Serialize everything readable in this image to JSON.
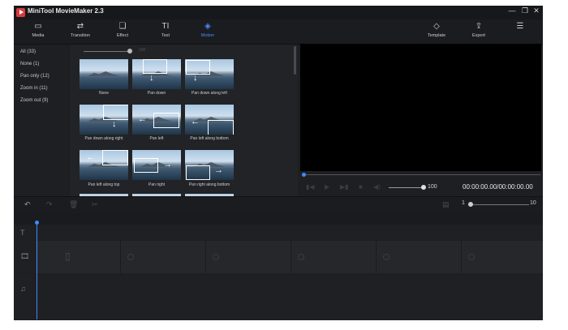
{
  "app": {
    "title": "MiniTool MovieMaker 2.3"
  },
  "window_controls": {
    "minimize": "—",
    "restore": "❐",
    "close": "✕"
  },
  "toolbar": {
    "tabs": [
      {
        "label": "Media",
        "icon": "folder-icon"
      },
      {
        "label": "Transition",
        "icon": "transition-icon"
      },
      {
        "label": "Effect",
        "icon": "effect-icon"
      },
      {
        "label": "Text",
        "icon": "text-icon"
      },
      {
        "label": "Motion",
        "icon": "motion-icon",
        "active": true
      }
    ],
    "right": [
      {
        "label": "Template",
        "icon": "template-icon"
      },
      {
        "label": "Export",
        "icon": "export-icon"
      }
    ],
    "menu_icon": "hamburger-menu-icon"
  },
  "sidebar": {
    "categories": [
      "All (33)",
      "None (1)",
      "Pan only (12)",
      "Zoom in (11)",
      "Zoom out (9)"
    ]
  },
  "panel": {
    "zoom_value": "100",
    "thumbnails": [
      {
        "label": "None"
      },
      {
        "label": "Pan down"
      },
      {
        "label": "Pan down along left"
      },
      {
        "label": "Pan down along right"
      },
      {
        "label": "Pan left"
      },
      {
        "label": "Pan left along bottom"
      },
      {
        "label": "Pan left along top"
      },
      {
        "label": "Pan right"
      },
      {
        "label": "Pan right along bottom"
      }
    ]
  },
  "player": {
    "volume": "100",
    "timecode": "00:00:00.00/00:00:00.00"
  },
  "timeline": {
    "zoom_min": "1",
    "zoom_max": "10",
    "tracks": [
      {
        "icon": "text-track-icon",
        "glyph": "T"
      },
      {
        "icon": "video-track-icon",
        "glyph": "🎞"
      },
      {
        "icon": "music-track-icon",
        "glyph": "♫"
      }
    ]
  },
  "colors": {
    "accent": "#3d8bff",
    "background": "#1e1f23",
    "logo": "#d63b3b"
  }
}
